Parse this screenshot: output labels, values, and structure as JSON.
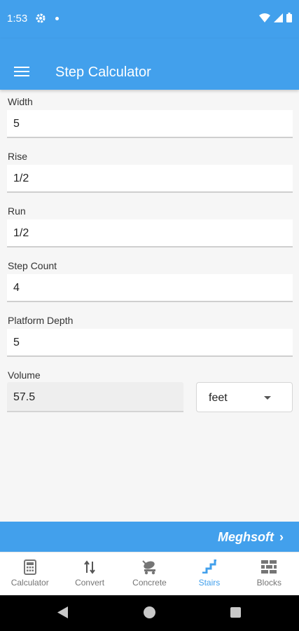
{
  "status_bar": {
    "time": "1:53"
  },
  "app_bar": {
    "title": "Step Calculator"
  },
  "form": {
    "width": {
      "label": "Width",
      "value": "5"
    },
    "rise": {
      "label": "Rise",
      "value": "1/2"
    },
    "run": {
      "label": "Run",
      "value": "1/2"
    },
    "step_count": {
      "label": "Step Count",
      "value": "4"
    },
    "platform_depth": {
      "label": "Platform Depth",
      "value": "5"
    },
    "volume": {
      "label": "Volume",
      "value": "57.5"
    },
    "unit": {
      "selected": "feet"
    }
  },
  "banner": {
    "text": "Meghsoft",
    "chevron": "›"
  },
  "bottom_nav": {
    "active": "Stairs",
    "items": [
      {
        "label": "Calculator",
        "icon": "calculator-icon"
      },
      {
        "label": "Convert",
        "icon": "convert-arrows-icon"
      },
      {
        "label": "Concrete",
        "icon": "concrete-mixer-icon"
      },
      {
        "label": "Stairs",
        "icon": "stairs-icon"
      },
      {
        "label": "Blocks",
        "icon": "blocks-icon"
      }
    ]
  },
  "colors": {
    "primary": "#42a0ec",
    "inactive": "#757575",
    "background": "#f6f6f6"
  }
}
